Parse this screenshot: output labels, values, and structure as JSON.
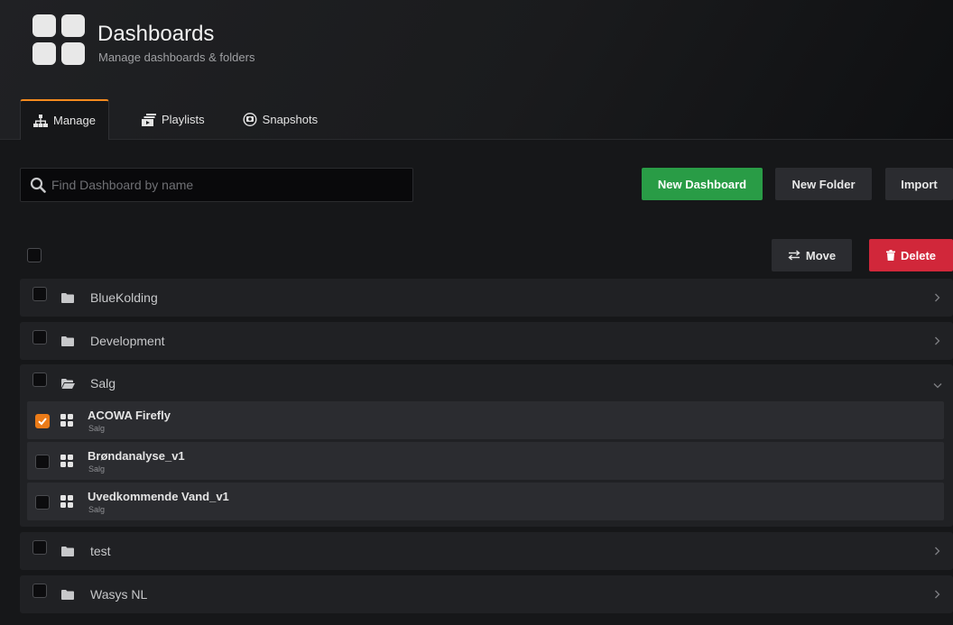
{
  "header": {
    "title": "Dashboards",
    "subtitle": "Manage dashboards & folders",
    "logo_icon": "dashboard-grid-icon"
  },
  "tabs": [
    {
      "label": "Manage",
      "icon": "sitemap-icon",
      "active": true
    },
    {
      "label": "Playlists",
      "icon": "playlist-icon",
      "active": false
    },
    {
      "label": "Snapshots",
      "icon": "snapshot-icon",
      "active": false
    }
  ],
  "search": {
    "placeholder": "Find Dashboard by name",
    "value": ""
  },
  "actions": {
    "new_dashboard": "New Dashboard",
    "new_folder": "New Folder",
    "import": "Import",
    "move": "Move",
    "delete": "Delete"
  },
  "folders": [
    {
      "name": "BlueKolding",
      "expanded": false
    },
    {
      "name": "Development",
      "expanded": false
    },
    {
      "name": "Salg",
      "expanded": true
    },
    {
      "name": "test",
      "expanded": false
    },
    {
      "name": "Wasys NL",
      "expanded": false
    }
  ],
  "salg_dashboards": [
    {
      "title": "ACOWA Firefly",
      "folder": "Salg",
      "checked": true
    },
    {
      "title": "Brøndanalyse_v1",
      "folder": "Salg",
      "checked": false
    },
    {
      "title": "Uvedkommende Vand_v1",
      "folder": "Salg",
      "checked": false
    }
  ],
  "colors": {
    "accent": "#eb7b18",
    "primary_button": "#299c46",
    "danger_button": "#d1273a",
    "background": "#161719",
    "row": "#202124"
  }
}
